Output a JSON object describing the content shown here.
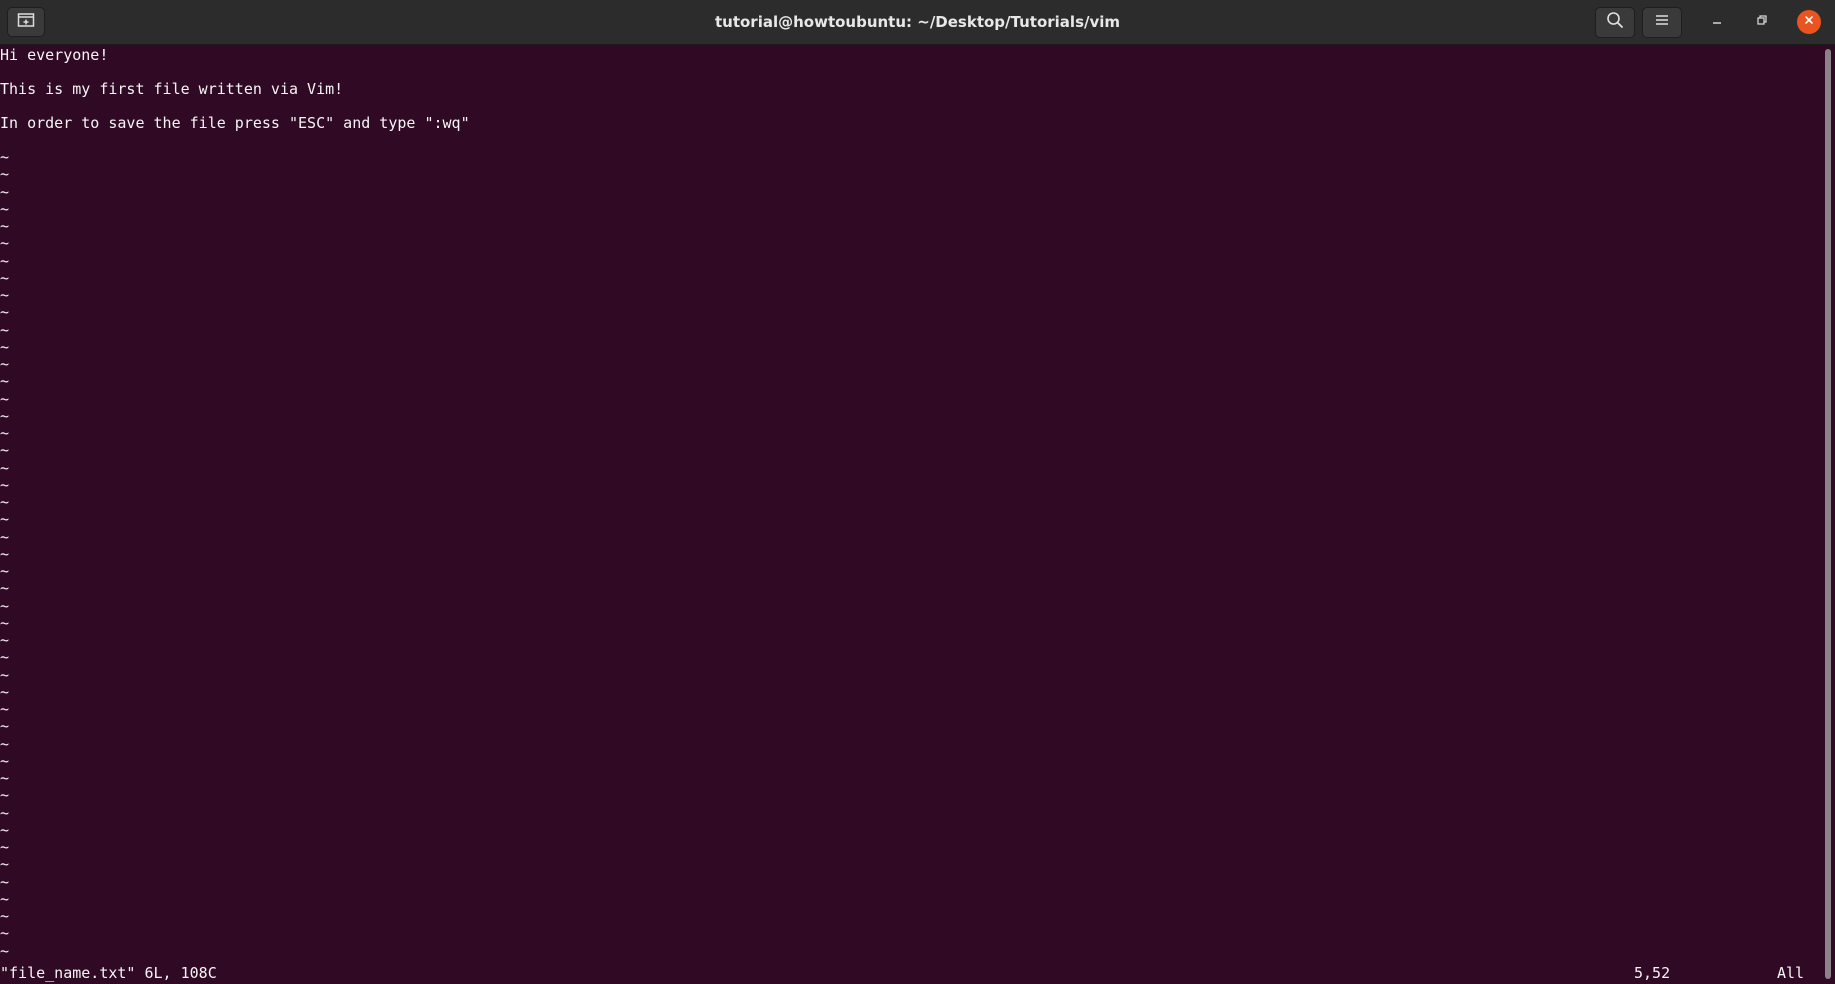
{
  "titlebar": {
    "title": "tutorial@howtoubuntu: ~/Desktop/Tutorials/vim",
    "icons": {
      "new_tab": "new-tab-icon",
      "search": "search-icon",
      "menu": "hamburger-menu-icon",
      "minimize": "minimize-icon",
      "maximize": "maximize-icon",
      "close": "close-icon"
    }
  },
  "editor": {
    "lines": [
      "Hi everyone!",
      "",
      "This is my first file written via Vim!",
      "",
      "In order to save the file press \"ESC\" and type \":wq\"",
      ""
    ],
    "empty_line_marker": "~"
  },
  "status": {
    "file_info": "\"file_name.txt\" 6L, 108C",
    "cursor_position": "5,52",
    "scroll_position": "All"
  },
  "colors": {
    "terminal_background": "#300a24",
    "titlebar_background": "#2c2c2c",
    "text": "#f5f5f5",
    "close_button": "#e95420"
  }
}
